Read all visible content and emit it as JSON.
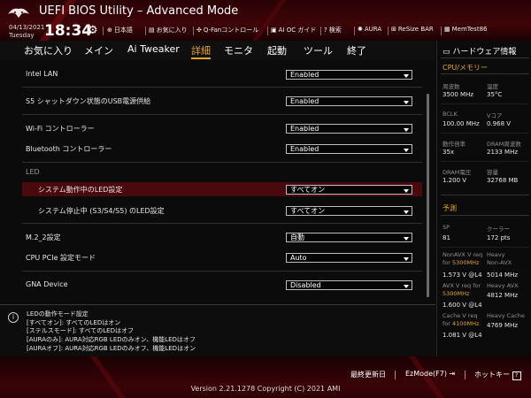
{
  "header": {
    "title": "UEFI BIOS Utility – Advanced Mode",
    "date": "04/13/2021",
    "day": "Tuesday",
    "time": "18:34",
    "toolbar": [
      {
        "icon": "globe-icon",
        "label": "日本語"
      },
      {
        "icon": "favorites-icon",
        "label": "お気に入り"
      },
      {
        "icon": "fan-icon",
        "label": "Q-Fanコントロール"
      },
      {
        "icon": "ai-oc-icon",
        "label": "AI OC ガイド"
      },
      {
        "icon": "search-icon",
        "label": "検索"
      },
      {
        "icon": "aura-icon",
        "label": "AURA"
      },
      {
        "icon": "resize-bar-icon",
        "label": "ReSize BAR"
      },
      {
        "icon": "memtest-icon",
        "label": "MemTest86"
      }
    ]
  },
  "menu": {
    "items": [
      "お気に入り",
      "メイン",
      "Ai Tweaker",
      "詳細",
      "モニタ",
      "起動",
      "ツール",
      "終了"
    ],
    "active": "詳細"
  },
  "settings": {
    "intel_lan": {
      "label": "Intel LAN",
      "value": "Enabled"
    },
    "s5_usb": {
      "label": "S5 シャットダウン状態のUSB電源供給",
      "value": "Enabled"
    },
    "wifi": {
      "label": "Wi-Fi コントローラー",
      "value": "Enabled"
    },
    "bluetooth": {
      "label": "Bluetooth コントローラー",
      "value": "Enabled"
    },
    "led_section": "LED",
    "led_working": {
      "label": "システム動作中のLED設定",
      "value": "すべてオン"
    },
    "led_sleep": {
      "label": "システム停止中 (S3/S4/S5) のLED設定",
      "value": "すべてオン"
    },
    "m2_2": {
      "label": "M.2_2設定",
      "value": "自動"
    },
    "cpu_pcie": {
      "label": "CPU PCIe 設定モード",
      "value": "Auto"
    },
    "gna": {
      "label": "GNA Device",
      "value": "Disabled"
    }
  },
  "info": {
    "icon": "info-icon",
    "lines": [
      "LEDの動作モード設定",
      "[すべてオン]: すべてのLEDはオン",
      "[ステルスモード]: すべてのLEDはオフ",
      "[AURAのみ]: AURA対応RGB LEDのみオン、機能LEDはオフ",
      "[AURAオフ]: AURA対応RGB LEDのみオフ、機能LEDはオン"
    ]
  },
  "hw_monitor": {
    "title": "ハードウェア情報",
    "cpu_section": "CPU/メモリー",
    "freq_label": "周波数",
    "freq_value": "3500 MHz",
    "temp_label": "温度",
    "temp_value": "35°C",
    "bclk_label": "BCLK",
    "bclk_value": "100.00 MHz",
    "vcore_label": "Vコア",
    "vcore_value": "0.968 V",
    "ratio_label": "動作倍率",
    "ratio_value": "35x",
    "dram_freq_label": "DRAM周波数",
    "dram_freq_value": "2133 MHz",
    "dram_volt_label": "DRAM電圧",
    "dram_volt_value": "1.200 V",
    "capacity_label": "容量",
    "capacity_value": "32768 MB",
    "predict_section": "予測",
    "sp_label": "SP",
    "sp_value": "81",
    "cooler_label": "クーラー",
    "cooler_value": "172 pts",
    "nonavx_req_label": "NonAVX V req",
    "nonavx_for": "for",
    "nonavx_freq": "5300MHz",
    "nonavx_value": "1.573 V @L4",
    "heavy_nonavx_label1": "Heavy",
    "heavy_nonavx_label2": "Non-AVX",
    "heavy_nonavx_value": "5014 MHz",
    "avx_req_label": "AVX V req for",
    "avx_freq": "5300MHz",
    "avx_value": "1.600 V @L4",
    "heavy_avx_label": "Heavy AVX",
    "heavy_avx_value": "4812 MHz",
    "cache_req_label": "Cache V req",
    "cache_for": "for",
    "cache_freq": "4100MHz",
    "cache_value": "1.081 V @L4",
    "heavy_cache_label": "Heavy Cache",
    "heavy_cache_value": "4769 MHz"
  },
  "footer": {
    "last_modified": "最終更新日",
    "ezmode": "EzMode(F7)",
    "hotkeys": "ホットキー",
    "hotkeys_icon": "?",
    "version": "Version 2.21.1278 Copyright (C) 2021 AMI"
  },
  "colors": {
    "accent": "#e6a229",
    "selected_row": "#4a0a0d",
    "header_red": "#3d0508"
  }
}
